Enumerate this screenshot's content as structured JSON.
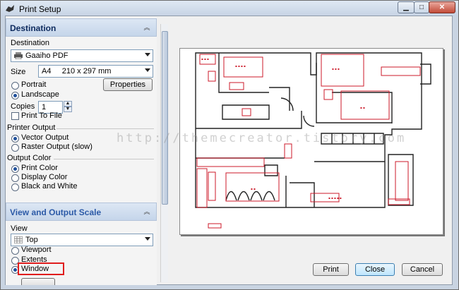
{
  "window": {
    "title": "Print Setup"
  },
  "destination_section": {
    "header": "Destination",
    "label": "Destination",
    "printer": "Gaaiho PDF",
    "size_label": "Size",
    "size_value": "A4     210 x 297 mm",
    "orientation": {
      "portrait": "Portrait",
      "landscape": "Landscape",
      "selected": "Landscape"
    },
    "properties_button": "Properties",
    "copies_label": "Copies",
    "copies_value": "1",
    "print_to_file": "Print To File",
    "printer_output_label": "Printer Output",
    "vector_output": "Vector Output",
    "raster_output": "Raster Output (slow)",
    "output_color_label": "Output Color",
    "print_color": "Print Color",
    "display_color": "Display Color",
    "black_white": "Black and White"
  },
  "view_section": {
    "header": "View and Output Scale",
    "view_label": "View",
    "view_value": "Top",
    "viewport": "Viewport",
    "extents": "Extents",
    "window_opt": "Window",
    "selected": "Window"
  },
  "watermark": "http://themecreator.tistory.com",
  "footer": {
    "print": "Print",
    "close": "Close",
    "cancel": "Cancel"
  },
  "colors": {
    "accent_red": "#e01d1d",
    "plan_red": "#cc1a2a"
  }
}
